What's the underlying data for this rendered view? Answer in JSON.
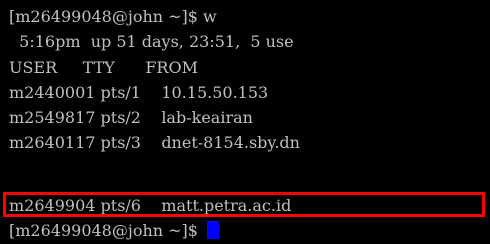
{
  "terminal": {
    "lines": [
      "[m26499048@john ~]$ w",
      "  5:16pm  up 51 days, 23:51,  5 use",
      "USER     TTY      FROM",
      "m2440001 pts/1    10.15.50.153",
      "m2549817 pts/2    lab-keairan",
      "m2640117 pts/3    dnet-8154.sby.dn",
      "m2649904 pts/6    matt.petra.ac.id",
      "[m26499048@john ~]$ "
    ]
  },
  "colors": {
    "background": "#000000",
    "text": "#c0c0c0",
    "cursor": "#0000ff",
    "highlight_border": "#ff0000"
  }
}
